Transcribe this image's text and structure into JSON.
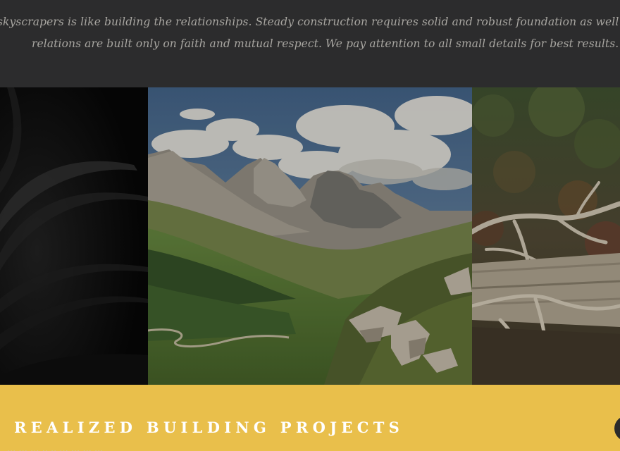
{
  "intro": {
    "line1": "skyscrapers is like building the relationships. Steady construction requires solid and robust foundation as well as pro",
    "line2": "relations are built only on faith and mutual respect. We pay attention to all small details for best results."
  },
  "gallery": {
    "images": [
      {
        "name": "open-book-photo",
        "description": "open book pages in the dark"
      },
      {
        "name": "mountain-valley-photo",
        "description": "mountain peaks over a green valley"
      },
      {
        "name": "forest-driftwood-photo",
        "description": "weathered driftwood in a forest"
      }
    ]
  },
  "projects": {
    "title": "REALIZED BUILDING PROJECTS",
    "subtext": "...  ...  ...  ..  ..  ...  ...  ...  ..."
  },
  "colors": {
    "quote_background": "#2c2c2d",
    "quote_text": "#a8a6a1",
    "projects_background": "#e9bf4b",
    "projects_title": "#ffffff"
  }
}
